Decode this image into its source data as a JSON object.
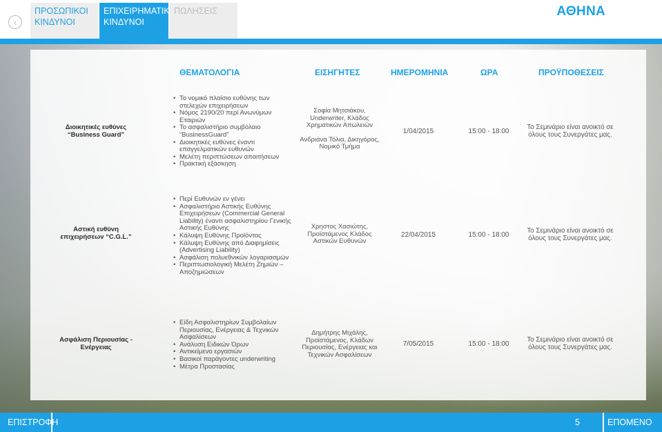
{
  "nav": {
    "tabs": [
      "ΠΡΟΣΩΠΙΚΟΙ ΚΙΝΔΥΝΟΙ",
      "ΕΠΙΧΕΙΡΗΜΑΤΙΚΟΙ ΚΙΝΔΥΝΟΙ",
      "ΠΩΛΗΣΕΙΣ"
    ],
    "active_tab": "ΕΠΙΧΕΙΡΗΜΑΤΙΚΟΙ ΚΙΝΔΥΝΟΙ",
    "back_icon": "chevron-left-icon",
    "city": "ΑΘΗΝΑ"
  },
  "table": {
    "headers": [
      "ΘΕΜΑΤΟΛΟΓΙΑ",
      "ΕΙΣΗΓΗΤΕΣ",
      "ΗΜΕΡΟΜΗΝΙΑ",
      "ΩΡΑ",
      "ΠΡΟΫΠΟΘΕΣΕΙΣ"
    ],
    "rows": [
      {
        "subject": "Διοικητικές ευθύνες “Business Guard”",
        "topics": [
          "Το νομικό πλαίσιο ευθύνης των στελεχών επιχειρήσεων",
          "Νόμος 2190/20 περί Ανωνύμων Εταιριών",
          "Το ασφαλιστήριο συμβόλαιο “BusinessGuard”",
          "Διοικητικές ευθύνες έναντι επαγγελματικών ευθυνών",
          "Μελέτη περιπτώσεων απαιτήσεων",
          "Πρακτική εξάσκηση"
        ],
        "speakers": [
          "Σοφία Μητσιάκου, Underwriter, Κλάδος Χρηματικών Απωλειών",
          "Ανδριάνα Τόλια, Δικηγόρος, Νομικό Τμήμα"
        ],
        "date": "1/04/2015",
        "time": "15:00 - 18:00",
        "conditions": "Το Σεμινάριο είναι ανοικτό σε όλους τους Συνεργάτες μας."
      },
      {
        "subject": "Αστική ευθύνη επιχειρήσεων “C.G.L.”",
        "topics": [
          "Περί Ευθυνών εν γένει",
          "Ασφαλιστήριο Αστικής Ευθύνης Επιχειρήσεων (Commercial General Liability) έναντι ασφαλιστηρίου Γενικής Αστικής Ευθύνης",
          "Κάλυψη Ευθύνης Προϊόντος",
          "Κάλυψη Ευθύνης από Διαφημίσεις (Advertising Liability)",
          "Ασφάλιση πολυεθνικών λογαριασμών",
          "Περιπτωσιολογική Μελέτη Ζημιών – Αποζημιώσεων"
        ],
        "speakers": [
          "Χρηστος Χασιώτης, Προϊστάμενος Κλάδος Αστικών Ευθυνών"
        ],
        "date": "22/04/2015",
        "time": "15:00 - 18:00",
        "conditions": "Το Σεμινάριο είναι ανοικτό σε όλους τους Συνεργάτες μας."
      },
      {
        "subject": "Ασφάλιση Περιουσίας - Ενέργειας",
        "topics": [
          "Είδη Ασφαλιστηρίων Συμβολαίων Περιουσίας, Ενέργειας & Τεχνικών Ασφαλίσεων",
          "Ανάλυση Ειδικών Όρων",
          "Αντικείμενο εργασιών",
          "Βασικοί παράγοντες underwriting",
          "Μέτρα Προστασίας"
        ],
        "speakers": [
          "Δημήτρης Μιχάλης, Προϊστάμενος, Κλάδων Περιουσίας, Ενέργειας και Τεχνικών Ασφαλίσεων"
        ],
        "date": "7/05/2015",
        "time": "15:00 - 18:00",
        "conditions": "Το Σεμινάριο είναι ανοικτό σε όλους τους Συνεργάτες μας."
      }
    ]
  },
  "footer": {
    "back_label": "ΕΠΙΣΤΡΟΦΗ",
    "page_number": "5",
    "next_label": "ΕΠΟΜΕΝΟ"
  },
  "colors": {
    "accent": "#1ea1e4",
    "tab_inactive_bg": "#ededed",
    "tab_disabled_text": "#bdbdbd"
  }
}
